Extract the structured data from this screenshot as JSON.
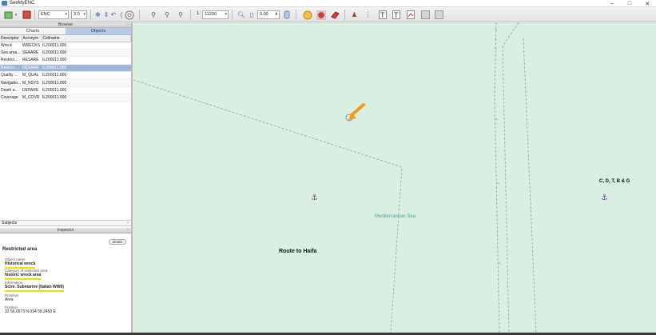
{
  "window": {
    "title": "SeeMyENC"
  },
  "window_controls": {
    "minimize": "–",
    "maximize": "□",
    "close": "✕"
  },
  "toolbar": {
    "select_mode": "ENC",
    "select_version": "3.0",
    "scale_prefix": "1:",
    "scale_value": "11200",
    "angle_value": "0.00",
    "icons": [
      "open-icon",
      "save-icon",
      "pan-icon",
      "rotate-icon",
      "compass-icon",
      "zoom-in-icon",
      "zoom-out-icon",
      "zoom-area-icon",
      "search-icon",
      "ruler-icon",
      "layer-icon",
      "circle-yellow-icon",
      "circle-red-icon",
      "eraser-icon",
      "person-icon",
      "grid-icon",
      "text-icon",
      "text-box-icon",
      "chart-icon",
      "print-icon",
      "export-icon"
    ]
  },
  "browser": {
    "header": "Browser",
    "tabs": [
      "Charts",
      "Objects"
    ],
    "active_tab": "Objects",
    "columns": [
      "Descriptor",
      "Acronym",
      "Cellname"
    ],
    "rows": [
      [
        "Wreck",
        "WRECKS",
        "IL200011.000"
      ],
      [
        "Sea area...",
        "SEAARE",
        "IL200011.000"
      ],
      [
        "Restrict...",
        "RESARE",
        "IL200011.000"
      ],
      [
        "Restrict...",
        "RESARE",
        "IL200011.000"
      ],
      [
        "Quality ...",
        "M_QUAL",
        "IL200011.000"
      ],
      [
        "Navigatio...",
        "M_NSYS",
        "IL200011.000"
      ],
      [
        "Depth a...",
        "DEPARE",
        "IL200011.000"
      ],
      [
        "Coverage",
        "M_COVR",
        "IL200011.000"
      ]
    ],
    "selected_row": 3
  },
  "objects_bar": {
    "label": "Subjects"
  },
  "inspector": {
    "header": "Inspector",
    "details_button": "details",
    "object_title": "Restricted area",
    "fields": [
      {
        "label": "Object name",
        "value": "Historical wreck",
        "highlight": true
      },
      {
        "label": "Category of restricted area",
        "value": "historic wreck area",
        "highlight": true
      },
      {
        "label": "Information",
        "value": "Scire: Submarine (Italian WWII)",
        "highlight": true
      },
      {
        "label": "Primitive",
        "value": "Area",
        "highlight": false
      },
      {
        "label": "Position",
        "value": "32 56.0573 N  034 58.2450 E",
        "highlight": false
      }
    ]
  },
  "map": {
    "labels": {
      "route": "Route to Haifa",
      "sea": "Mediterranean Sea",
      "cdtbg": "C, D, T, B & G"
    },
    "colors": {
      "sea": "#d8efe1",
      "boundary": "#9aa09d",
      "anchor": "#6a3c86",
      "pointer": "#f29a1d"
    }
  }
}
